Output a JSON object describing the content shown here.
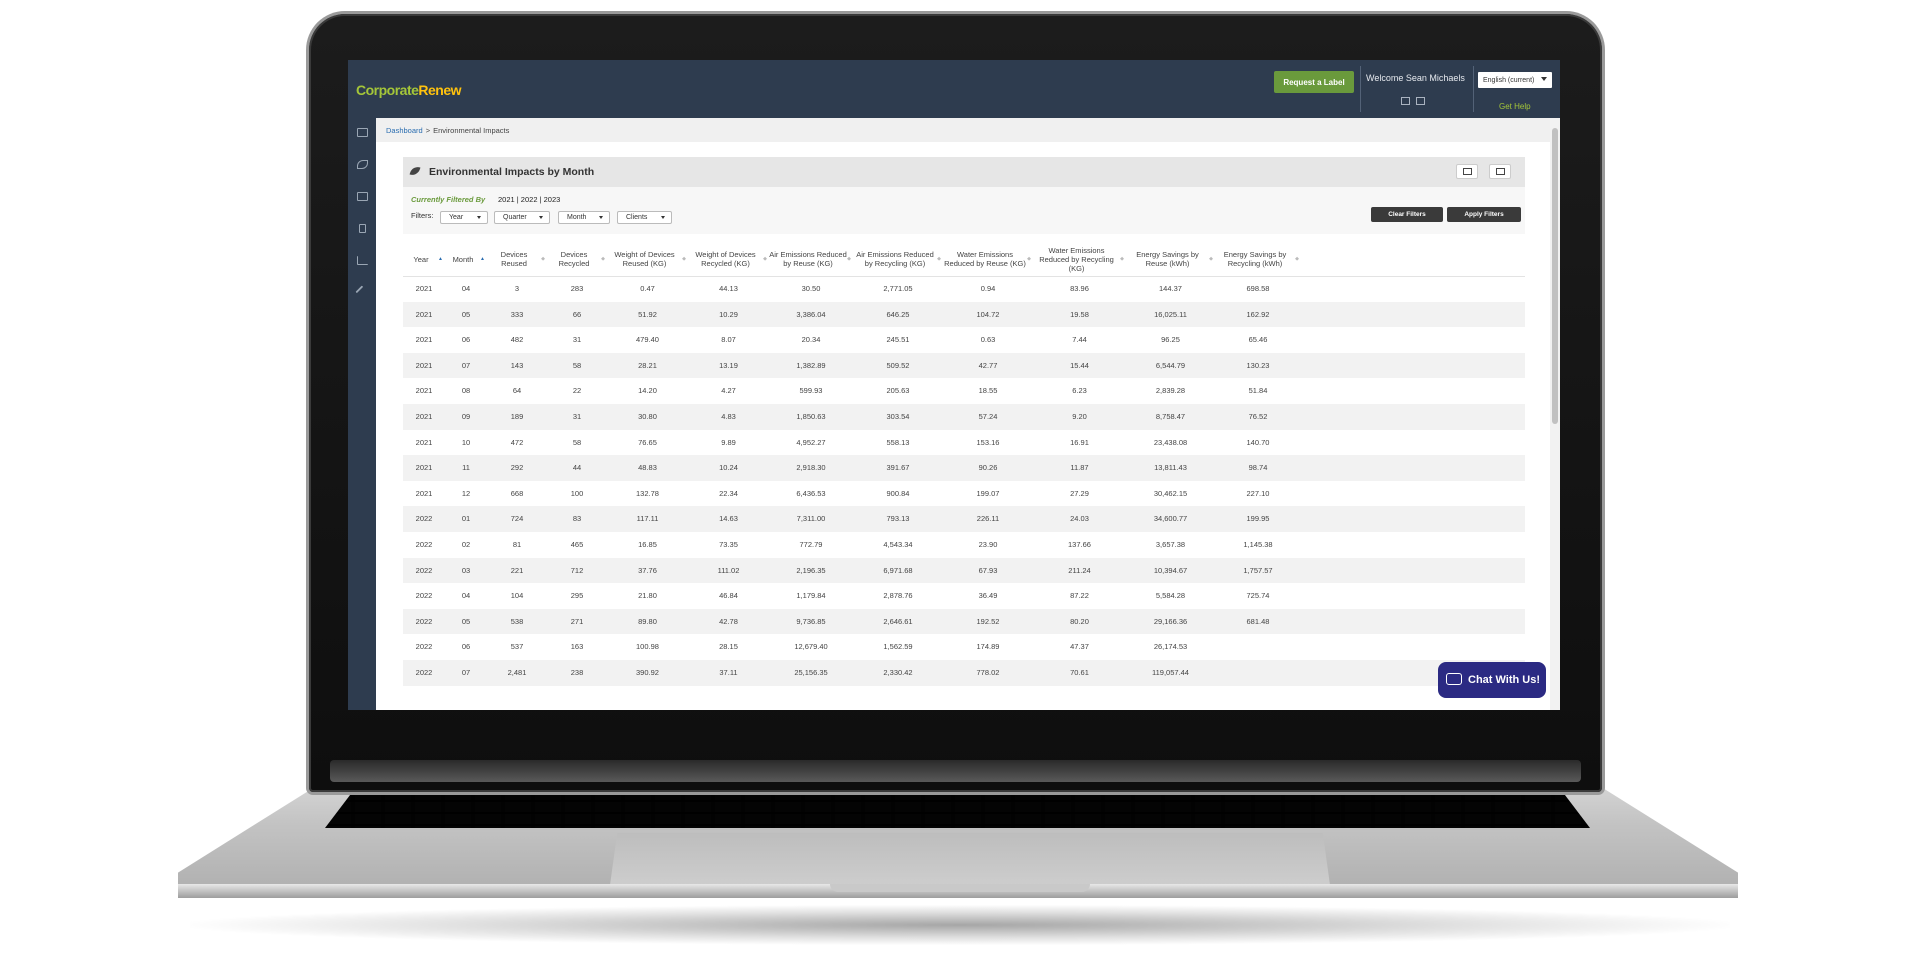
{
  "header": {
    "logo_part1": "Corporate",
    "logo_part2": "Renew",
    "request_label": "Request a Label",
    "welcome": "Welcome Sean Michaels",
    "language": "English (current)",
    "get_help": "Get Help"
  },
  "breadcrumb": {
    "home": "Dashboard",
    "separator": ">",
    "current": "Environmental Impacts"
  },
  "panel": {
    "title": "Environmental Impacts by Month",
    "filtered_by_label": "Currently Filtered By",
    "filtered_by_value": "2021 | 2022 | 2023",
    "filters_label": "Filters:",
    "filters": [
      "Year",
      "Quarter",
      "Month",
      "Clients"
    ],
    "clear_filters": "Clear Filters",
    "apply_filters": "Apply Filters"
  },
  "table": {
    "headers": [
      "Year",
      "Month",
      "Devices Reused",
      "Devices Recycled",
      "Weight of Devices Reused (KG)",
      "Weight of Devices Recycled (KG)",
      "Air Emissions Reduced by Reuse (KG)",
      "Air Emissions Reduced by Recycling (KG)",
      "Water Emissions Reduced by Reuse (KG)",
      "Water Emissions Reduced by Recycling (KG)",
      "Energy Savings by Reuse (kWh)",
      "Energy Savings by Recycling (kWh)"
    ],
    "rows": [
      [
        "2021",
        "04",
        "3",
        "283",
        "0.47",
        "44.13",
        "30.50",
        "2,771.05",
        "0.94",
        "83.96",
        "144.37",
        "698.58"
      ],
      [
        "2021",
        "05",
        "333",
        "66",
        "51.92",
        "10.29",
        "3,386.04",
        "646.25",
        "104.72",
        "19.58",
        "16,025.11",
        "162.92"
      ],
      [
        "2021",
        "06",
        "482",
        "31",
        "479.40",
        "8.07",
        "20.34",
        "245.51",
        "0.63",
        "7.44",
        "96.25",
        "65.46"
      ],
      [
        "2021",
        "07",
        "143",
        "58",
        "28.21",
        "13.19",
        "1,382.89",
        "509.52",
        "42.77",
        "15.44",
        "6,544.79",
        "130.23"
      ],
      [
        "2021",
        "08",
        "64",
        "22",
        "14.20",
        "4.27",
        "599.93",
        "205.63",
        "18.55",
        "6.23",
        "2,839.28",
        "51.84"
      ],
      [
        "2021",
        "09",
        "189",
        "31",
        "30.80",
        "4.83",
        "1,850.63",
        "303.54",
        "57.24",
        "9.20",
        "8,758.47",
        "76.52"
      ],
      [
        "2021",
        "10",
        "472",
        "58",
        "76.65",
        "9.89",
        "4,952.27",
        "558.13",
        "153.16",
        "16.91",
        "23,438.08",
        "140.70"
      ],
      [
        "2021",
        "11",
        "292",
        "44",
        "48.83",
        "10.24",
        "2,918.30",
        "391.67",
        "90.26",
        "11.87",
        "13,811.43",
        "98.74"
      ],
      [
        "2021",
        "12",
        "668",
        "100",
        "132.78",
        "22.34",
        "6,436.53",
        "900.84",
        "199.07",
        "27.29",
        "30,462.15",
        "227.10"
      ],
      [
        "2022",
        "01",
        "724",
        "83",
        "117.11",
        "14.63",
        "7,311.00",
        "793.13",
        "226.11",
        "24.03",
        "34,600.77",
        "199.95"
      ],
      [
        "2022",
        "02",
        "81",
        "465",
        "16.85",
        "73.35",
        "772.79",
        "4,543.34",
        "23.90",
        "137.66",
        "3,657.38",
        "1,145.38"
      ],
      [
        "2022",
        "03",
        "221",
        "712",
        "37.76",
        "111.02",
        "2,196.35",
        "6,971.68",
        "67.93",
        "211.24",
        "10,394.67",
        "1,757.57"
      ],
      [
        "2022",
        "04",
        "104",
        "295",
        "21.80",
        "46.84",
        "1,179.84",
        "2,878.76",
        "36.49",
        "87.22",
        "5,584.28",
        "725.74"
      ],
      [
        "2022",
        "05",
        "538",
        "271",
        "89.80",
        "42.78",
        "9,736.85",
        "2,646.61",
        "192.52",
        "80.20",
        "29,166.36",
        "681.48"
      ],
      [
        "2022",
        "06",
        "537",
        "163",
        "100.98",
        "28.15",
        "12,679.40",
        "1,562.59",
        "174.89",
        "47.37",
        "26,174.53",
        ""
      ],
      [
        "2022",
        "07",
        "2,481",
        "238",
        "390.92",
        "37.11",
        "25,156.35",
        "2,330.42",
        "778.02",
        "70.61",
        "119,057.44",
        ""
      ]
    ]
  },
  "chat": {
    "label": "Chat With Us!"
  },
  "colors": {
    "topbar": "#2e3c4f",
    "accent_green": "#6a9a3c",
    "logo_yellow": "#ffc20e",
    "chat_button": "#2b2a83"
  },
  "icons": {
    "sidebar": [
      "dashboard-icon",
      "leaf-icon",
      "document-icon",
      "mobile-icon",
      "chart-icon",
      "tools-icon"
    ],
    "export": "excel-icon",
    "print": "print-icon"
  }
}
